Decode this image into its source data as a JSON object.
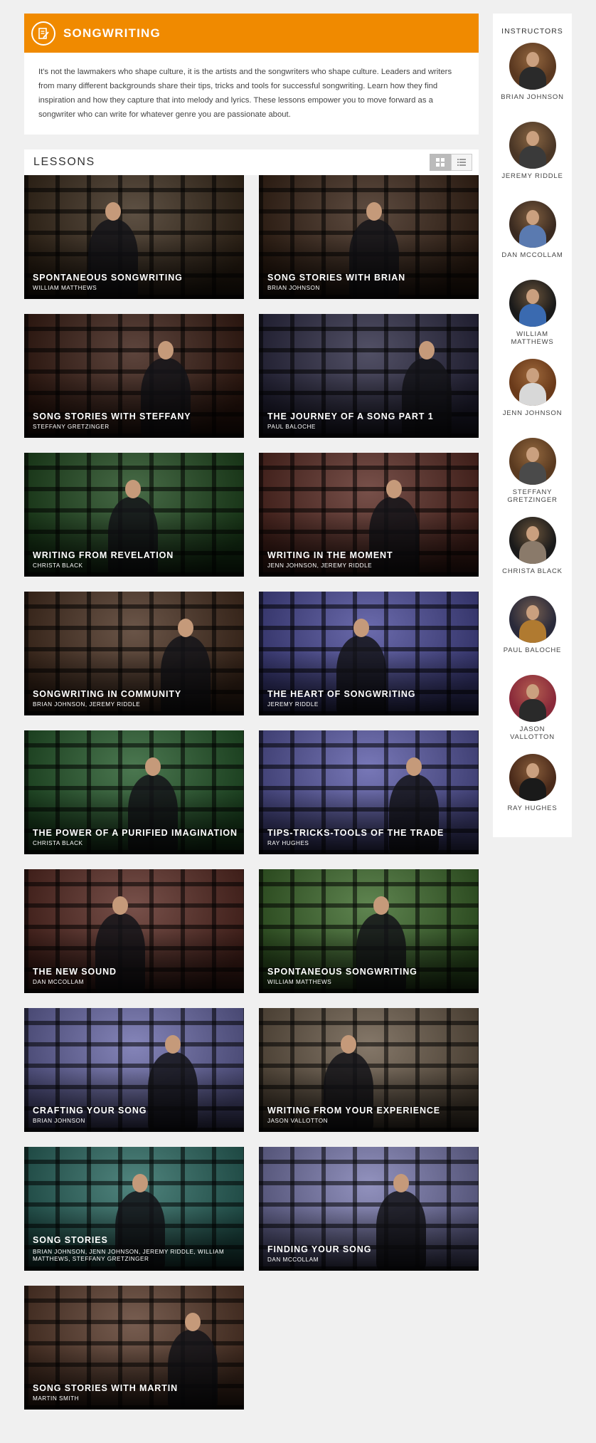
{
  "header": {
    "title": "SONGWRITING",
    "icon": "notepad-pencil-icon",
    "accent_color": "#f08a00",
    "description": "It's not the lawmakers who shape culture, it is the artists and the songwriters who shape culture. Leaders and writers from many different backgrounds share their tips, tricks and tools for successful songwriting. Learn how they find inspiration and how they capture that into melody and lyrics. These lessons empower you to move forward as a songwriter who can write for whatever genre you are passionate about."
  },
  "lessons": {
    "title": "LESSONS",
    "view_grid_icon": "grid-view-icon",
    "view_list_icon": "list-view-icon",
    "items": [
      {
        "title": "SPONTANEOUS SONGWRITING",
        "subtitle": "WILLIAM MATTHEWS",
        "bg": "#3a2a1a"
      },
      {
        "title": "SONG STORIES WITH BRIAN",
        "subtitle": "BRIAN JOHNSON",
        "bg": "#3a2416"
      },
      {
        "title": "SONG STORIES WITH STEFFANY",
        "subtitle": "STEFFANY GRETZINGER",
        "bg": "#3a1c12"
      },
      {
        "title": "THE JOURNEY OF A SONG PART 1",
        "subtitle": "PAUL BALOCHE",
        "bg": "#2c2a44"
      },
      {
        "title": "WRITING FROM REVELATION",
        "subtitle": "CHRISTA BLACK",
        "bg": "#1f4a1e"
      },
      {
        "title": "WRITING IN THE MOMENT",
        "subtitle": "JENN JOHNSON, JEREMY RIDDLE",
        "bg": "#5a2a22"
      },
      {
        "title": "SONGWRITING IN COMMUNITY",
        "subtitle": "BRIAN JOHNSON, JEREMY RIDDLE",
        "bg": "#4a3020"
      },
      {
        "title": "THE HEART OF SONGWRITING",
        "subtitle": "JEREMY RIDDLE",
        "bg": "#4a4a9a"
      },
      {
        "title": "THE POWER OF A PURIFIED IMAGINATION",
        "subtitle": "CHRISTA BLACK",
        "bg": "#245a2a"
      },
      {
        "title": "TIPS-TRICKS-TOOLS OF THE TRADE",
        "subtitle": "RAY HUGHES",
        "bg": "#5a5aa8"
      },
      {
        "title": "THE NEW SOUND",
        "subtitle": "DAN MCCOLLAM",
        "bg": "#5a2a22"
      },
      {
        "title": "SPONTANEOUS SONGWRITING",
        "subtitle": "WILLIAM MATTHEWS",
        "bg": "#3c6a2a"
      },
      {
        "title": "CRAFTING YOUR SONG",
        "subtitle": "BRIAN JOHNSON",
        "bg": "#6a6aaa"
      },
      {
        "title": "WRITING FROM YOUR EXPERIENCE",
        "subtitle": "JASON VALLOTTON",
        "bg": "#6a5a48"
      },
      {
        "title": "SONG STORIES",
        "subtitle": "BRIAN JOHNSON, JENN JOHNSON, JEREMY RIDDLE, WILLIAM MATTHEWS, STEFFANY GRETZINGER",
        "bg": "#2a6a62"
      },
      {
        "title": "FINDING YOUR SONG",
        "subtitle": "DAN MCCOLLAM",
        "bg": "#7a7ab0"
      },
      {
        "title": "SONG STORIES WITH MARTIN",
        "subtitle": "MARTIN SMITH",
        "bg": "#5a3a2a"
      }
    ]
  },
  "instructors": {
    "title": "INSTRUCTORS",
    "items": [
      {
        "name": "BRIAN JOHNSON",
        "bg": "#5a3820",
        "shirt": "#2a2a2a"
      },
      {
        "name": "JEREMY RIDDLE",
        "bg": "#4a3626",
        "shirt": "#3a3a3a"
      },
      {
        "name": "DAN MCCOLLAM",
        "bg": "#3a2a20",
        "shirt": "#5a7ab0"
      },
      {
        "name": "WILLIAM MATTHEWS",
        "bg": "#1a1a1a",
        "shirt": "#3a6ab0"
      },
      {
        "name": "JENN JOHNSON",
        "bg": "#6a3a1a",
        "shirt": "#d8d8d8"
      },
      {
        "name": "STEFFANY GRETZINGER",
        "bg": "#5a3a20",
        "shirt": "#4a4a4a"
      },
      {
        "name": "CHRISTA BLACK",
        "bg": "#1a1a1a",
        "shirt": "#8a7a6a"
      },
      {
        "name": "PAUL BALOCHE",
        "bg": "#2a2a3a",
        "shirt": "#b07a30"
      },
      {
        "name": "JASON VALLOTTON",
        "bg": "#8a2a3a",
        "shirt": "#2a2a2a"
      },
      {
        "name": "RAY HUGHES",
        "bg": "#4a2a1a",
        "shirt": "#1a1a1a"
      }
    ]
  }
}
